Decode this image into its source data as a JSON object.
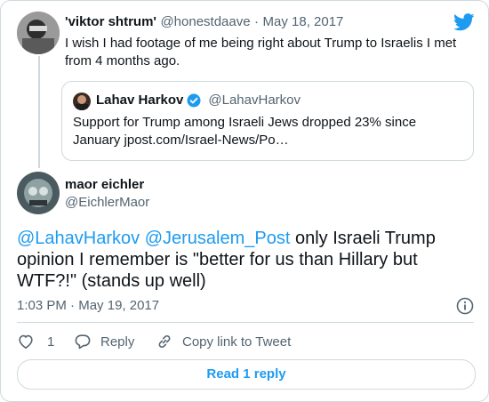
{
  "first_tweet": {
    "display_name": "'viktor shtrum'",
    "handle": "@honestdaave",
    "separator": "·",
    "date": "May 18, 2017",
    "text": "I wish I had footage of me being right about Trump to Israelis I met from 4 months ago."
  },
  "quoted_tweet": {
    "display_name": "Lahav Harkov",
    "handle": "@LahavHarkov",
    "text": "Support for Trump among Israeli Jews dropped 23% since January jpost.com/Israel-News/Po…"
  },
  "main_tweet": {
    "display_name": "maor eichler",
    "handle": "@EichlerMaor",
    "mention_1": "@LahavHarkov",
    "mention_2": "@Jerusalem_Post",
    "body": "only Israeli Trump opinion I remember is \"better for us than Hillary but WTF?!\" (stands up well)",
    "time": "1:03 PM",
    "separator": "·",
    "date": "May 19, 2017"
  },
  "actions": {
    "like_count": "1",
    "reply_label": "Reply",
    "copy_link_label": "Copy link to Tweet"
  },
  "read_replies_label": "Read 1 reply",
  "colors": {
    "accent": "#1d9bf0",
    "text": "#0f1419",
    "muted": "#536471",
    "border": "#cfd9de"
  },
  "icons": [
    "twitter-bird-icon",
    "verified-badge-icon",
    "info-icon",
    "heart-icon",
    "reply-icon",
    "link-icon"
  ]
}
